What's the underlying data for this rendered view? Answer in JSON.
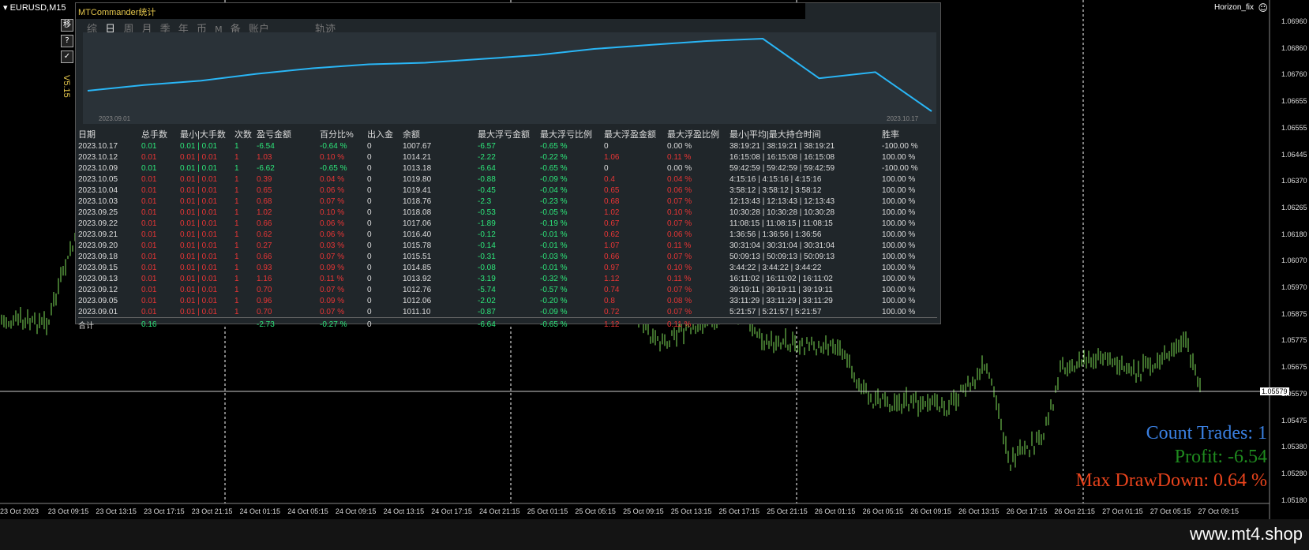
{
  "chart": {
    "symbol": "EURUSD,M15",
    "indicator_name": "Horizon_fix",
    "current_price": "1.05579",
    "y_labels": [
      "1.06960",
      "1.06860",
      "1.06760",
      "1.06655",
      "1.06555",
      "1.06445",
      "1.06370",
      "1.06265",
      "1.06180",
      "1.06070",
      "1.05970",
      "1.05875",
      "1.05775",
      "1.05675",
      "1.05579",
      "1.05475",
      "1.05380",
      "1.05280",
      "1.05180"
    ],
    "x_labels": [
      "23 Oct 2023",
      "23 Oct 09:15",
      "23 Oct 13:15",
      "23 Oct 17:15",
      "23 Oct 21:15",
      "24 Oct 01:15",
      "24 Oct 05:15",
      "24 Oct 09:15",
      "24 Oct 13:15",
      "24 Oct 17:15",
      "24 Oct 21:15",
      "25 Oct 01:15",
      "25 Oct 05:15",
      "25 Oct 09:15",
      "25 Oct 13:15",
      "25 Oct 17:15",
      "25 Oct 21:15",
      "26 Oct 01:15",
      "26 Oct 05:15",
      "26 Oct 09:15",
      "26 Oct 13:15",
      "26 Oct 17:15",
      "26 Oct 21:15",
      "27 Oct 01:15",
      "27 Oct 05:15",
      "27 Oct 09:15"
    ],
    "colors": {
      "candle": "#7fe05a",
      "grid": "#ffffff",
      "bg": "#000000"
    }
  },
  "side_buttons": [
    {
      "label": "移",
      "icon": "move-icon"
    },
    {
      "label": "?",
      "icon": "help-icon"
    },
    {
      "label": "✓",
      "icon": "check-icon"
    }
  ],
  "version": "V5.15",
  "panel": {
    "title": "MTCommander统计",
    "tabs": [
      "综",
      "日",
      "周",
      "月",
      "季",
      "年",
      "币",
      "M",
      "备",
      "账户",
      "轨迹"
    ],
    "active_tab": "日",
    "equity": {
      "start_date": "2023.09.01",
      "end_date": "2023.10.17",
      "values": [
        1011.1,
        1012.06,
        1012.76,
        1013.92,
        1014.85,
        1015.51,
        1015.78,
        1016.4,
        1017.06,
        1018.08,
        1018.76,
        1019.41,
        1019.8,
        1013.18,
        1014.21,
        1007.67
      ]
    },
    "headers": [
      "日期",
      "总手数",
      "最小|大手数",
      "次数",
      "盈亏金额",
      "百分比%",
      "出入金",
      "余额",
      "最大浮亏金额",
      "最大浮亏比例",
      "最大浮盈金额",
      "最大浮盈比例",
      "最小|平均|最大持仓时间",
      "胜率"
    ],
    "rows": [
      [
        "2023.10.17",
        "0.01",
        "0.01 | 0.01",
        "1",
        "-6.54",
        "-0.64 %",
        "0",
        "1007.67",
        "-6.57",
        "-0.65 %",
        "0",
        "0.00 %",
        "38:19:21 | 38:19:21 | 38:19:21",
        "-100.00 %"
      ],
      [
        "2023.10.12",
        "0.01",
        "0.01 | 0.01",
        "1",
        "1.03",
        "0.10 %",
        "0",
        "1014.21",
        "-2.22",
        "-0.22 %",
        "1.06",
        "0.11 %",
        "16:15:08 | 16:15:08 | 16:15:08",
        "100.00 %"
      ],
      [
        "2023.10.09",
        "0.01",
        "0.01 | 0.01",
        "1",
        "-6.62",
        "-0.65 %",
        "0",
        "1013.18",
        "-6.64",
        "-0.65 %",
        "0",
        "0.00 %",
        "59:42:59 | 59:42:59 | 59:42:59",
        "-100.00 %"
      ],
      [
        "2023.10.05",
        "0.01",
        "0.01 | 0.01",
        "1",
        "0.39",
        "0.04 %",
        "0",
        "1019.80",
        "-0.88",
        "-0.09 %",
        "0.4",
        "0.04 %",
        "4:15:16 | 4:15:16 | 4:15:16",
        "100.00 %"
      ],
      [
        "2023.10.04",
        "0.01",
        "0.01 | 0.01",
        "1",
        "0.65",
        "0.06 %",
        "0",
        "1019.41",
        "-0.45",
        "-0.04 %",
        "0.65",
        "0.06 %",
        "3:58:12 | 3:58:12 | 3:58:12",
        "100.00 %"
      ],
      [
        "2023.10.03",
        "0.01",
        "0.01 | 0.01",
        "1",
        "0.68",
        "0.07 %",
        "0",
        "1018.76",
        "-2.3",
        "-0.23 %",
        "0.68",
        "0.07 %",
        "12:13:43 | 12:13:43 | 12:13:43",
        "100.00 %"
      ],
      [
        "2023.09.25",
        "0.01",
        "0.01 | 0.01",
        "1",
        "1.02",
        "0.10 %",
        "0",
        "1018.08",
        "-0.53",
        "-0.05 %",
        "1.02",
        "0.10 %",
        "10:30:28 | 10:30:28 | 10:30:28",
        "100.00 %"
      ],
      [
        "2023.09.22",
        "0.01",
        "0.01 | 0.01",
        "1",
        "0.66",
        "0.06 %",
        "0",
        "1017.06",
        "-1.89",
        "-0.19 %",
        "0.67",
        "0.07 %",
        "11:08:15 | 11:08:15 | 11:08:15",
        "100.00 %"
      ],
      [
        "2023.09.21",
        "0.01",
        "0.01 | 0.01",
        "1",
        "0.62",
        "0.06 %",
        "0",
        "1016.40",
        "-0.12",
        "-0.01 %",
        "0.62",
        "0.06 %",
        "1:36:56 | 1:36:56 | 1:36:56",
        "100.00 %"
      ],
      [
        "2023.09.20",
        "0.01",
        "0.01 | 0.01",
        "1",
        "0.27",
        "0.03 %",
        "0",
        "1015.78",
        "-0.14",
        "-0.01 %",
        "1.07",
        "0.11 %",
        "30:31:04 | 30:31:04 | 30:31:04",
        "100.00 %"
      ],
      [
        "2023.09.18",
        "0.01",
        "0.01 | 0.01",
        "1",
        "0.66",
        "0.07 %",
        "0",
        "1015.51",
        "-0.31",
        "-0.03 %",
        "0.66",
        "0.07 %",
        "50:09:13 | 50:09:13 | 50:09:13",
        "100.00 %"
      ],
      [
        "2023.09.15",
        "0.01",
        "0.01 | 0.01",
        "1",
        "0.93",
        "0.09 %",
        "0",
        "1014.85",
        "-0.08",
        "-0.01 %",
        "0.97",
        "0.10 %",
        "3:44:22 | 3:44:22 | 3:44:22",
        "100.00 %"
      ],
      [
        "2023.09.13",
        "0.01",
        "0.01 | 0.01",
        "1",
        "1.16",
        "0.11 %",
        "0",
        "1013.92",
        "-3.19",
        "-0.32 %",
        "1.12",
        "0.11 %",
        "16:11:02 | 16:11:02 | 16:11:02",
        "100.00 %"
      ],
      [
        "2023.09.12",
        "0.01",
        "0.01 | 0.01",
        "1",
        "0.70",
        "0.07 %",
        "0",
        "1012.76",
        "-5.74",
        "-0.57 %",
        "0.74",
        "0.07 %",
        "39:19:11 | 39:19:11 | 39:19:11",
        "100.00 %"
      ],
      [
        "2023.09.05",
        "0.01",
        "0.01 | 0.01",
        "1",
        "0.96",
        "0.09 %",
        "0",
        "1012.06",
        "-2.02",
        "-0.20 %",
        "0.8",
        "0.08 %",
        "33:11:29 | 33:11:29 | 33:11:29",
        "100.00 %"
      ],
      [
        "2023.09.01",
        "0.01",
        "0.01 | 0.01",
        "1",
        "0.70",
        "0.07 %",
        "0",
        "1011.10",
        "-0.87",
        "-0.09 %",
        "0.72",
        "0.07 %",
        "5:21:57 | 5:21:57 | 5:21:57",
        "100.00 %"
      ]
    ],
    "total": [
      "合计",
      "0.16",
      "",
      "",
      "-2.73",
      "-0.27 %",
      "0",
      "",
      "-6.64",
      "-0.65 %",
      "1.12",
      "0.11 %",
      "",
      ""
    ]
  },
  "stats": {
    "count_trades": "Count Trades: 1",
    "profit": "Profit: -6.54",
    "max_drawdown": "Max DrawDown: 0.64 %",
    "colors": {
      "count": "#3a7fe0",
      "profit": "#1f8a1f",
      "drawdown": "#e8431c"
    }
  },
  "watermark": "www.mt4.shop"
}
